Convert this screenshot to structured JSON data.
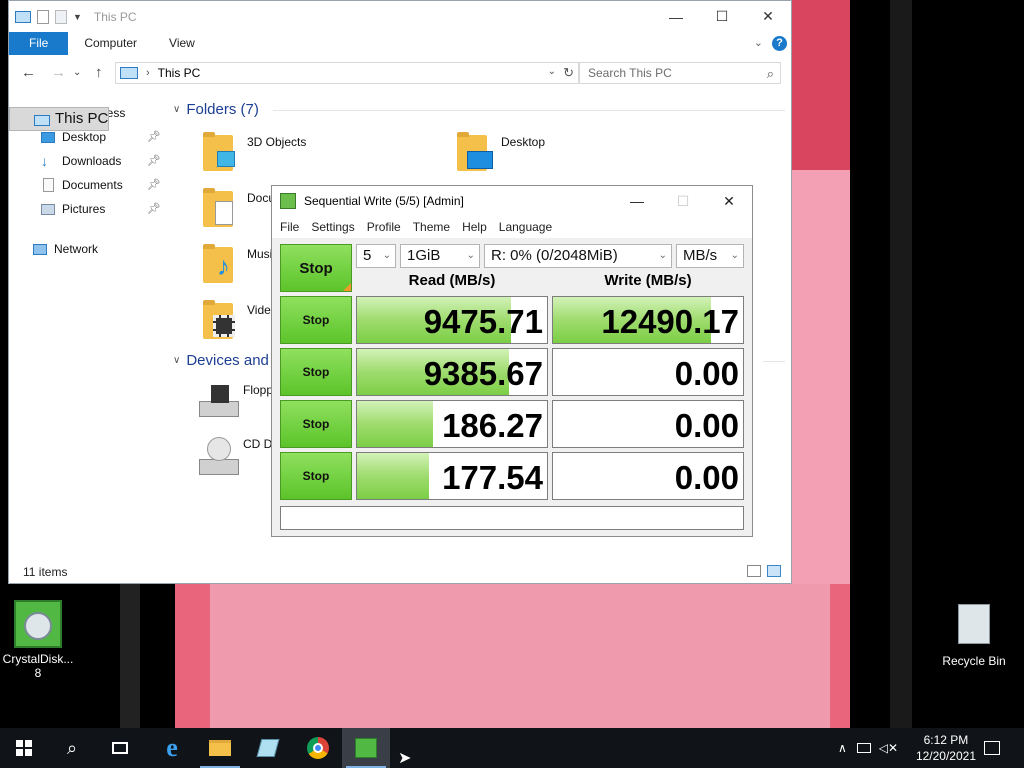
{
  "explorer": {
    "title": "This PC",
    "ribbon_tabs": [
      "File",
      "Computer",
      "View"
    ],
    "address": "This PC",
    "search_placeholder": "Search This PC",
    "nav": [
      {
        "label": "Quick access",
        "pinned": false
      },
      {
        "label": "Desktop",
        "pinned": true
      },
      {
        "label": "Downloads",
        "pinned": true
      },
      {
        "label": "Documents",
        "pinned": true
      },
      {
        "label": "Pictures",
        "pinned": true
      },
      {
        "label": "This PC",
        "pinned": false
      },
      {
        "label": "Network",
        "pinned": false
      }
    ],
    "folders_header": "Folders (7)",
    "folders": [
      "3D Objects",
      "Desktop",
      "Docur",
      "Music",
      "Videos"
    ],
    "devices_header": "Devices and",
    "devices": [
      "Floppy",
      "CD Dri"
    ],
    "status": "11 items"
  },
  "cdm": {
    "title": "Sequential Write (5/5) [Admin]",
    "menu": [
      "File",
      "Settings",
      "Profile",
      "Theme",
      "Help",
      "Language"
    ],
    "big_button": "Stop",
    "count": "5",
    "size": "1GiB",
    "drive": "R: 0% (0/2048MiB)",
    "unit": "MB/s",
    "read_header": "Read (MB/s)",
    "write_header": "Write (MB/s)",
    "rows": [
      {
        "button": "Stop",
        "read": "9475.71",
        "write": "12490.17",
        "read_fill": 0.81,
        "write_fill": 0.83
      },
      {
        "button": "Stop",
        "read": "9385.67",
        "write": "0.00",
        "read_fill": 0.8,
        "write_fill": 0
      },
      {
        "button": "Stop",
        "read": "186.27",
        "write": "0.00",
        "read_fill": 0.4,
        "write_fill": 0
      },
      {
        "button": "Stop",
        "read": "177.54",
        "write": "0.00",
        "read_fill": 0.38,
        "write_fill": 0
      }
    ]
  },
  "desktop_icons": {
    "crystal": "CrystalDisk... 8",
    "recycle": "Recycle Bin"
  },
  "taskbar": {
    "time": "6:12 PM",
    "date": "12/20/2021"
  }
}
